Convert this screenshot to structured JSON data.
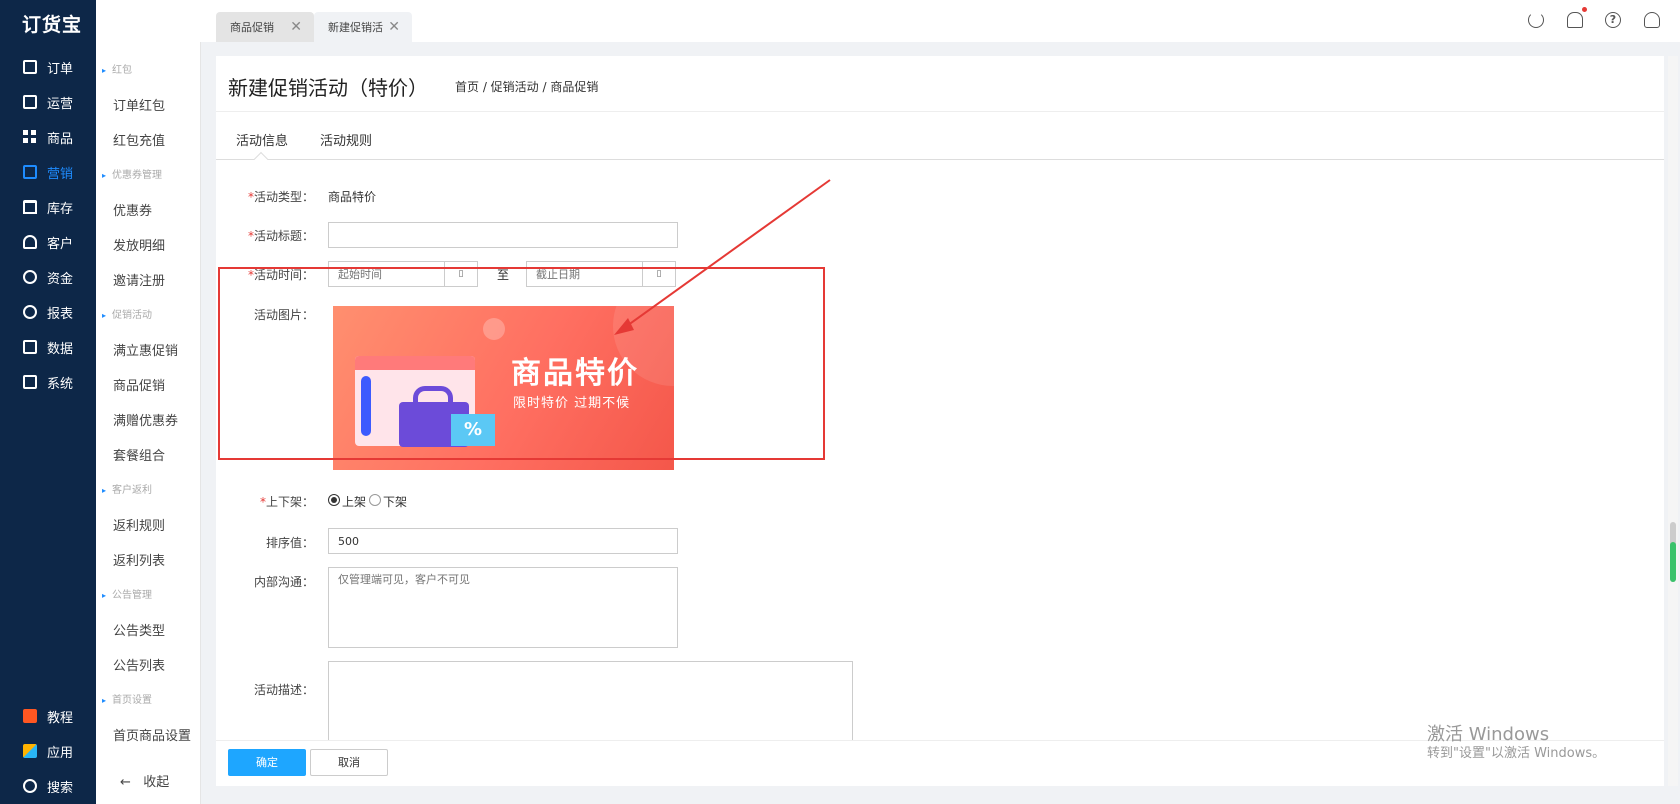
{
  "app": {
    "logo": "订货宝"
  },
  "nav": {
    "items": [
      {
        "label": "订单"
      },
      {
        "label": "运营"
      },
      {
        "label": "商品"
      },
      {
        "label": "营销"
      },
      {
        "label": "库存"
      },
      {
        "label": "客户"
      },
      {
        "label": "资金"
      },
      {
        "label": "报表"
      },
      {
        "label": "数据"
      },
      {
        "label": "系统"
      }
    ],
    "bottom": [
      {
        "label": "教程"
      },
      {
        "label": "应用"
      },
      {
        "label": "搜索"
      }
    ],
    "active": "营销"
  },
  "submenu": {
    "groups": [
      "红包",
      "优惠券管理",
      "促销活动",
      "客户返利",
      "公告管理",
      "首页设置"
    ],
    "items": [
      "订单红包",
      "红包充值",
      "优惠券",
      "发放明细",
      "邀请注册",
      "满立惠促销",
      "商品促销",
      "满赠优惠券",
      "套餐组合",
      "返利规则",
      "返利列表",
      "公告类型",
      "公告列表",
      "首页商品设置"
    ],
    "collapse": "收起"
  },
  "tabs": [
    {
      "label": "商品促销"
    },
    {
      "label": "新建促销活"
    }
  ],
  "page": {
    "title": "新建促销活动（特价）",
    "breadcrumb": "首页 / 促销活动 / 商品促销",
    "tabs": [
      "活动信息",
      "活动规则"
    ]
  },
  "form": {
    "type_label": "活动类型：",
    "type_value": "商品特价",
    "title_label": "活动标题：",
    "title_value": "",
    "time_label": "活动时间：",
    "start_placeholder": "起始时间",
    "end_placeholder": "截止日期",
    "to": "至",
    "image_label": "活动图片：",
    "shelf_label": "上下架：",
    "shelf_on": "上架",
    "shelf_off": "下架",
    "shelf_selected": "上架",
    "sort_label": "排序值：",
    "sort_value": "500",
    "internal_label": "内部沟通：",
    "internal_placeholder": "仅管理端可见，客户不可见",
    "desc_label": "活动描述：",
    "required_mark": "*"
  },
  "banner": {
    "title": "商品特价",
    "subtitle": "限时特价 过期不候",
    "percent": "%"
  },
  "buttons": {
    "ok": "确定",
    "cancel": "取消"
  },
  "watermark": {
    "line1": "激活 Windows",
    "line2": "转到\"设置\"以激活 Windows。"
  },
  "colors": {
    "nav_bg": "#0d2748",
    "accent": "#1ea6ff",
    "highlight": "#e53935",
    "banner": "#ff6f61"
  }
}
